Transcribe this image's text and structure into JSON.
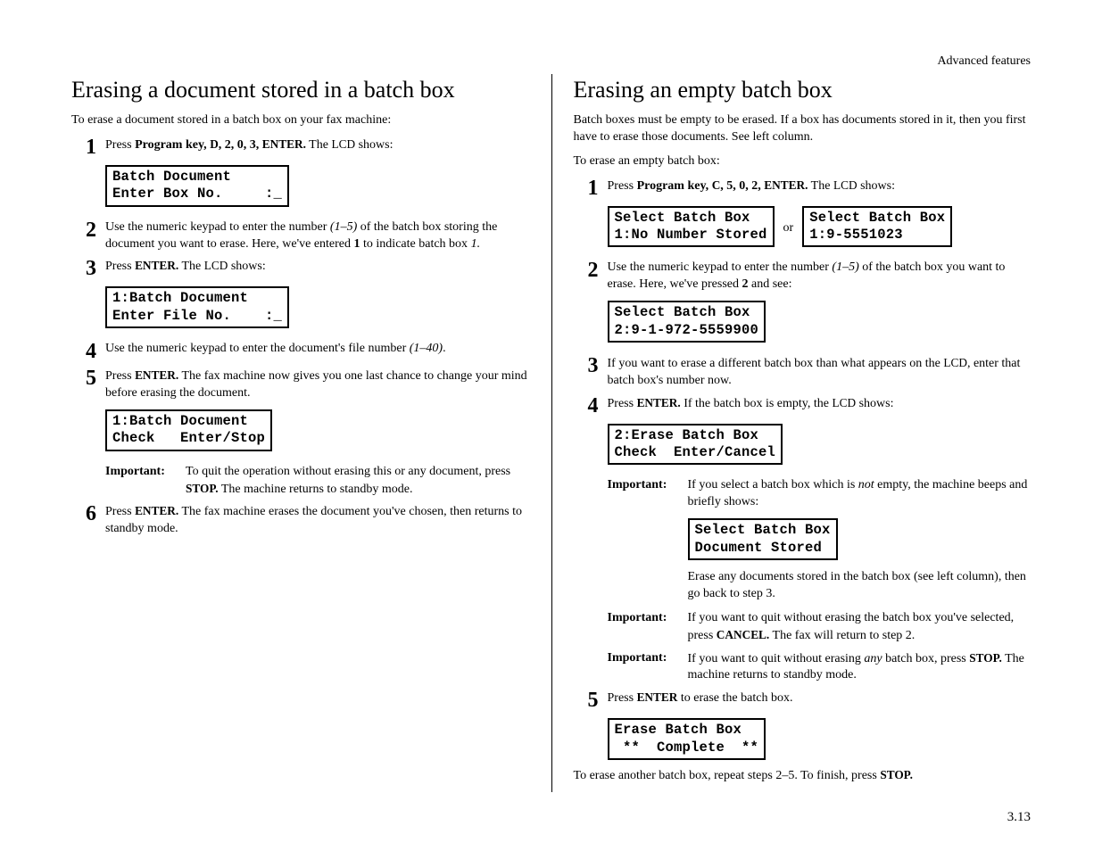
{
  "header": "Advanced features",
  "pagenum": "3.13",
  "left": {
    "title": "Erasing a document stored in a batch box",
    "intro": "To erase a document stored in a batch box on your fax machine:",
    "step1_a1": "Press ",
    "step1_b1": "Program key, ",
    "step1_key": "D",
    "step1_b2": ", 2, 0, 3, ",
    "step1_enter": "ENTER.",
    "step1_a2": " The ",
    "step1_lcdword": "LCD",
    "step1_a3": " shows:",
    "lcd1": "Batch Document\nEnter Box No.     :_",
    "step2_a": "Use the numeric keypad to enter the number ",
    "step2_i": "(1–5)",
    "step2_b": " of the batch box storing the document you want to erase. Here, we've entered ",
    "step2_bold": "1",
    "step2_c": " to indicate batch box ",
    "step2_i2": "1.",
    "step3_a": "Press ",
    "step3_enter": "ENTER.",
    "step3_b": " The ",
    "step3_lcdword": "LCD",
    "step3_c": " shows:",
    "lcd2": "1:Batch Document\nEnter File No.    :_",
    "step4_a": "Use the numeric keypad to enter the document's file number ",
    "step4_i": "(1–40)",
    "step4_b": ".",
    "step5_a": "Press ",
    "step5_enter": "ENTER.",
    "step5_b": " The fax machine now gives you one last chance to change your mind before erasing the document.",
    "lcd3": "1:Batch Document\nCheck   Enter/Stop",
    "imp_label": "Important:",
    "imp_a": "To quit the operation without erasing this or any document, press ",
    "imp_stop": "STOP.",
    "imp_b": " The machine returns to standby mode.",
    "step6_a": "Press ",
    "step6_enter": "ENTER.",
    "step6_b": " The fax machine erases the document you've chosen, then returns to standby mode."
  },
  "right": {
    "title": "Erasing an empty batch box",
    "intro1": "Batch boxes must be empty to be erased. If a box has documents stored in it, then you first have to erase those documents. See left column.",
    "intro2": "To erase an empty batch box:",
    "step1_a1": "Press ",
    "step1_b1": "Program key, ",
    "step1_key": "C",
    "step1_b2": ", 5, 0, 2, ",
    "step1_enter": "ENTER.",
    "step1_a2": " The ",
    "step1_lcdword": "LCD",
    "step1_a3": " shows:",
    "lcd1a": "Select Batch Box\n1:No Number Stored",
    "or": "or",
    "lcd1b": "Select Batch Box\n1:9-5551023",
    "step2_a": "Use the numeric keypad to enter the number ",
    "step2_i": "(1–5)",
    "step2_b": " of the batch box you want to erase. Here, we've pressed ",
    "step2_bold": "2",
    "step2_c": " and see:",
    "lcd2": "Select Batch Box\n2:9-1-972-5559900",
    "step3_a": "If you want to erase a different batch box than what appears on the ",
    "step3_lcdword": "LCD",
    "step3_b": ", enter that batch box's number now.",
    "step4_a": "Press ",
    "step4_enter": "ENTER.",
    "step4_b": " If the batch box is empty, the ",
    "step4_lcdword": "LCD",
    "step4_c": " shows:",
    "lcd3": "2:Erase Batch Box\nCheck  Enter/Cancel",
    "imp1_label": "Important:",
    "imp1_a": "If you select a batch box which is ",
    "imp1_not": "not",
    "imp1_b": " empty, the machine beeps and briefly shows:",
    "lcd4": "Select Batch Box\nDocument Stored",
    "imp1_c": "Erase any documents stored in the batch box (see left column), then go back to step 3.",
    "imp2_label": "Important:",
    "imp2_a": "If you want to quit without erasing the batch box you've selected, press ",
    "imp2_cancel": "CANCEL.",
    "imp2_b": " The fax will return to step 2.",
    "imp3_label": "Important:",
    "imp3_a": "If you want to quit without erasing ",
    "imp3_any": "any",
    "imp3_b": " batch box, press ",
    "imp3_stop": "STOP.",
    "imp3_c": " The machine returns to standby mode.",
    "step5_a": "Press ",
    "step5_enter": "ENTER",
    "step5_b": " to erase the batch box.",
    "lcd5": "Erase Batch Box\n **  Complete  **",
    "final_a": "To erase another batch box, repeat steps 2–5. To finish, press ",
    "final_stop": "STOP."
  }
}
